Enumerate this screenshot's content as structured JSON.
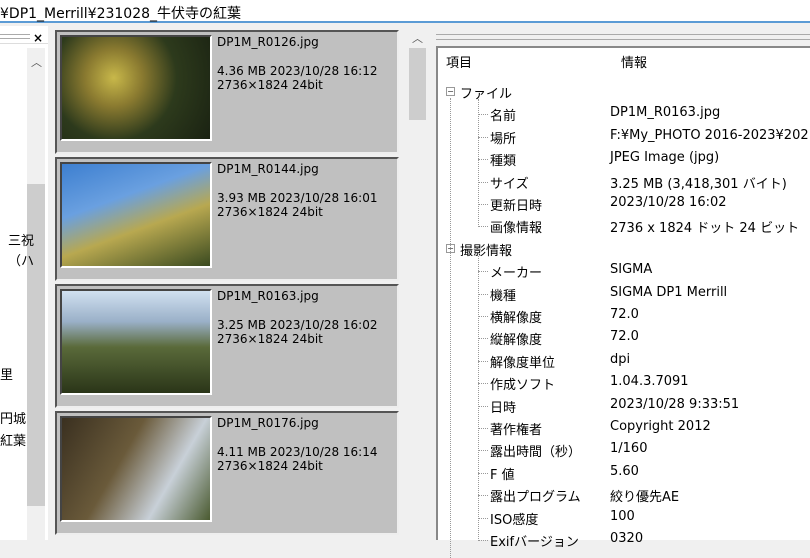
{
  "address": "¥DP1_Merrill¥231028_牛伏寺の紅葉",
  "left_panel": {
    "close": "×",
    "fragments": [
      "三祝",
      "（ハ",
      "里",
      "円城",
      "紅葉"
    ]
  },
  "thumbnails": [
    {
      "name": "DP1M_R0126.jpg",
      "size_date": "4.36 MB  2023/10/28 16:12",
      "dims": "2736×1824  24bit"
    },
    {
      "name": "DP1M_R0144.jpg",
      "size_date": "3.93 MB  2023/10/28 16:01",
      "dims": "2736×1824  24bit"
    },
    {
      "name": "DP1M_R0163.jpg",
      "size_date": "3.25 MB  2023/10/28 16:02",
      "dims": "2736×1824  24bit"
    },
    {
      "name": "DP1M_R0176.jpg",
      "size_date": "4.11 MB  2023/10/28 16:14",
      "dims": "2736×1824  24bit"
    }
  ],
  "props": {
    "col_item": "項目",
    "col_info": "情報",
    "groups": [
      {
        "label": "ファイル",
        "rows": [
          [
            "名前",
            "DP1M_R0163.jpg"
          ],
          [
            "場所",
            "F:¥My_PHOTO 2016-2023¥202..."
          ],
          [
            "種類",
            "JPEG Image (jpg)"
          ],
          [
            "サイズ",
            "3.25 MB (3,418,301 バイト)"
          ],
          [
            "更新日時",
            "2023/10/28 16:02"
          ],
          [
            "画像情報",
            "2736 x 1824 ドット 24 ビット"
          ]
        ]
      },
      {
        "label": "撮影情報",
        "rows": [
          [
            "メーカー",
            "SIGMA"
          ],
          [
            "機種",
            "SIGMA DP1 Merrill"
          ],
          [
            "横解像度",
            "72.0"
          ],
          [
            "縦解像度",
            "72.0"
          ],
          [
            "解像度単位",
            "dpi"
          ],
          [
            "作成ソフト",
            "1.04.3.7091"
          ],
          [
            "日時",
            "2023/10/28 9:33:51"
          ],
          [
            "著作権者",
            "Copyright 2012"
          ],
          [
            "露出時間（秒）",
            "1/160"
          ],
          [
            "F 値",
            "5.60"
          ],
          [
            "露出プログラム",
            "絞り優先AE"
          ],
          [
            "ISO感度",
            "100"
          ],
          [
            "Exifバージョン",
            "0320"
          ]
        ]
      }
    ]
  }
}
